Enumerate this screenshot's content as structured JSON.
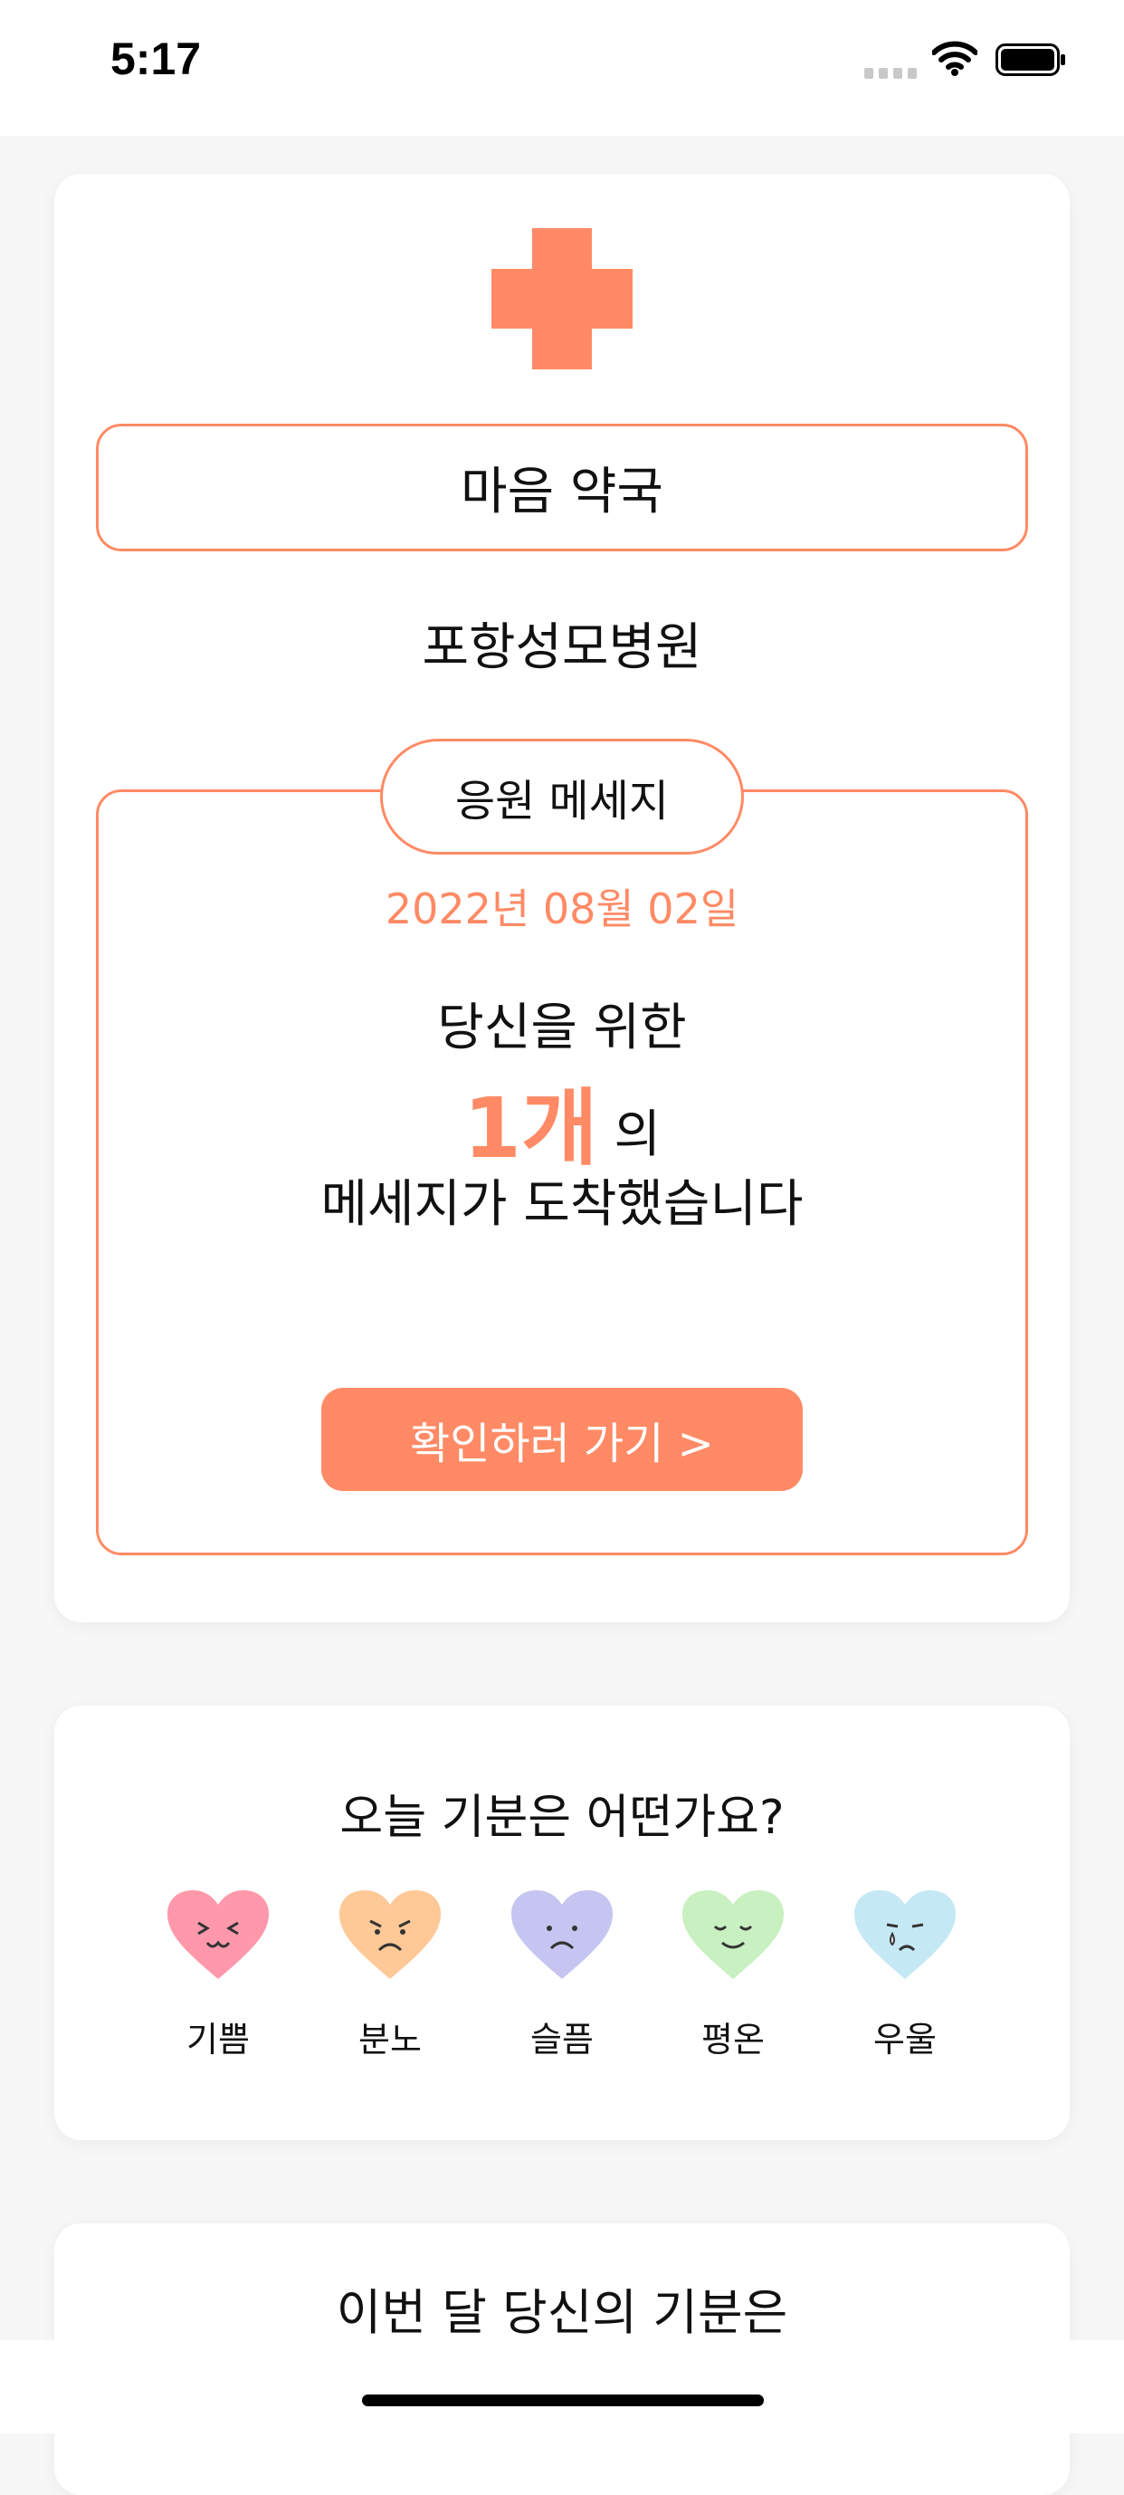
{
  "status": {
    "time": "5:17"
  },
  "header": {
    "title": "마음 약국",
    "hospital": "포항성모병원"
  },
  "message": {
    "tab_label": "응원 메세지",
    "date": "2022년 08월 02일",
    "line1": "당신을 위한",
    "count": "1개",
    "suffix": " 의",
    "line3": "메세지가 도착했습니다",
    "button_label": "확인하러 가기 >"
  },
  "mood": {
    "question": "오늘 기분은 어떤가요?",
    "items": [
      {
        "label": "기쁨",
        "color": "#ff98ab",
        "icon": "happy-heart-icon"
      },
      {
        "label": "분노",
        "color": "#ffc897",
        "icon": "angry-heart-icon"
      },
      {
        "label": "슬픔",
        "color": "#c6c5f1",
        "icon": "sad-heart-icon"
      },
      {
        "label": "평온",
        "color": "#c8f0c0",
        "icon": "calm-heart-icon"
      },
      {
        "label": "우울",
        "color": "#c5e8f5",
        "icon": "depressed-heart-icon"
      }
    ]
  },
  "monthly": {
    "title": "이번 달 당신의 기분은"
  },
  "colors": {
    "accent": "#ff8a65"
  }
}
